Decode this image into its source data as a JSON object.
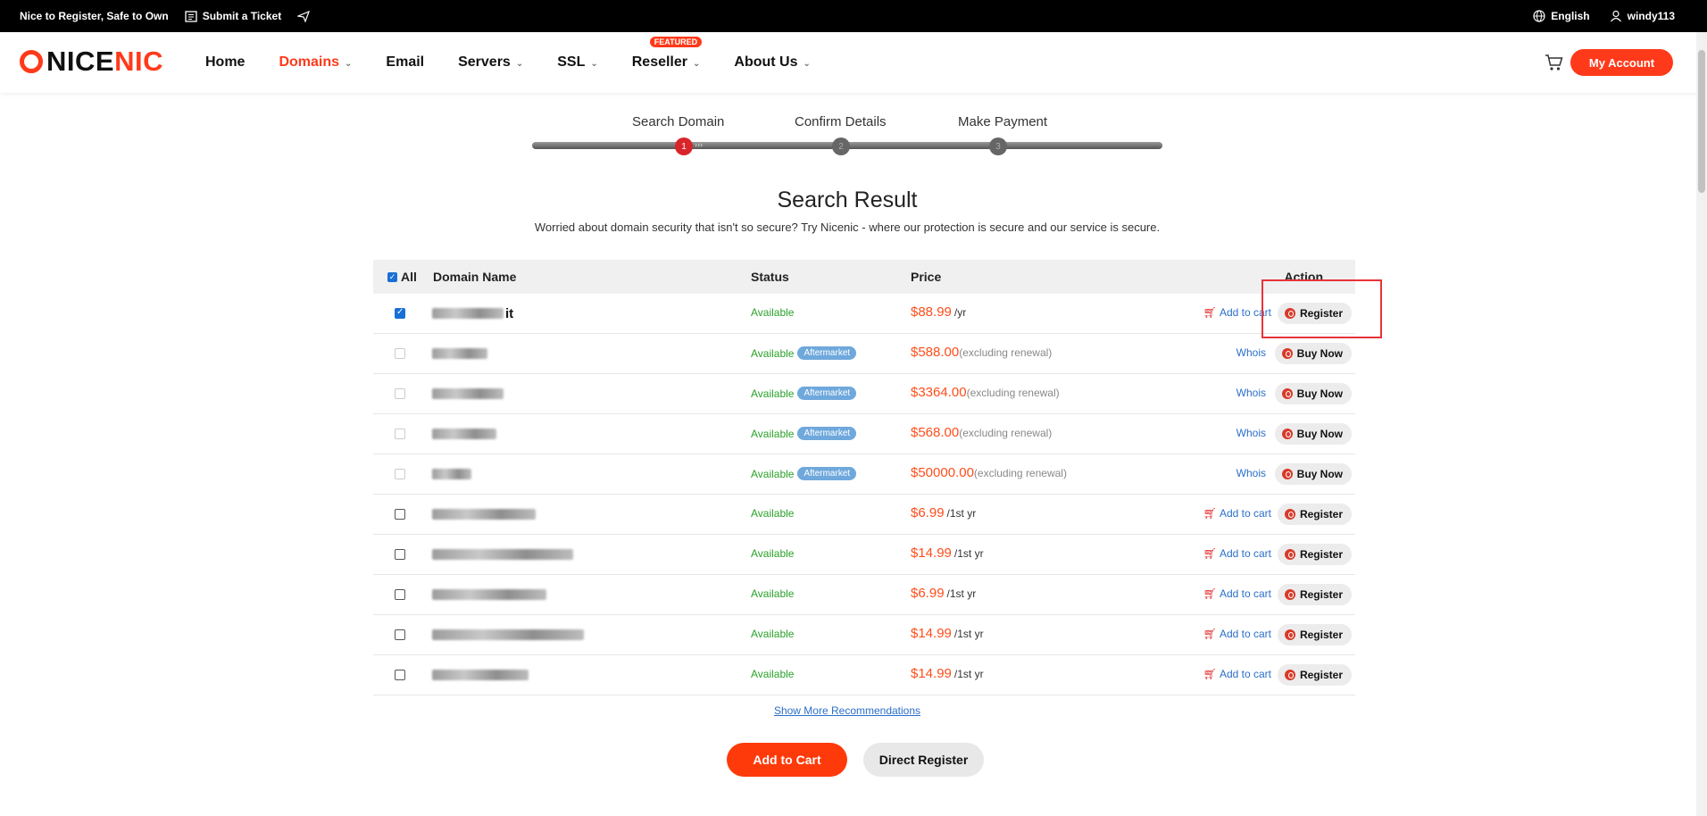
{
  "topbar": {
    "slogan": "Nice to Register, Safe to Own",
    "ticket": "Submit a Ticket",
    "language": "English",
    "username": "windy113"
  },
  "header": {
    "logo_part1": "NICE",
    "logo_part2": "NIC",
    "nav": {
      "home": "Home",
      "domains": "Domains",
      "email": "Email",
      "servers": "Servers",
      "ssl": "SSL",
      "reseller": "Reseller",
      "reseller_badge": "FEATURED",
      "about": "About Us"
    },
    "account": "My Account"
  },
  "steps": {
    "s1": "Search Domain",
    "s2": "Confirm Details",
    "s3": "Make Payment",
    "n1": "1",
    "n2": "2",
    "n3": "3"
  },
  "main": {
    "title": "Search Result",
    "subtitle": "Worried about domain security that isn't so secure? Try Nicenic - where our protection is secure and our service is secure."
  },
  "table": {
    "headers": {
      "all": "All",
      "domain": "Domain Name",
      "status": "Status",
      "price": "Price",
      "action": "Action"
    },
    "rows": [
      {
        "tld": "it",
        "status": "Available",
        "badge": "",
        "amount": "$88.99",
        "unit": "/yr",
        "link": "Add to cart",
        "action": "Register"
      },
      {
        "tld": "",
        "status": "Available",
        "badge": "Aftermarket",
        "amount": "$588.00",
        "unit": "(excluding renewal)",
        "link": "Whois",
        "action": "Buy Now"
      },
      {
        "tld": "",
        "status": "Available",
        "badge": "Aftermarket",
        "amount": "$3364.00",
        "unit": "(excluding renewal)",
        "link": "Whois",
        "action": "Buy Now"
      },
      {
        "tld": "",
        "status": "Available",
        "badge": "Aftermarket",
        "amount": "$568.00",
        "unit": "(excluding renewal)",
        "link": "Whois",
        "action": "Buy Now"
      },
      {
        "tld": "",
        "status": "Available",
        "badge": "Aftermarket",
        "amount": "$50000.00",
        "unit": "(excluding renewal)",
        "link": "Whois",
        "action": "Buy Now"
      },
      {
        "tld": "",
        "status": "Available",
        "badge": "",
        "amount": "$6.99",
        "unit": "/1st yr",
        "link": "Add to cart",
        "action": "Register"
      },
      {
        "tld": "",
        "status": "Available",
        "badge": "",
        "amount": "$14.99",
        "unit": "/1st yr",
        "link": "Add to cart",
        "action": "Register"
      },
      {
        "tld": "",
        "status": "Available",
        "badge": "",
        "amount": "$6.99",
        "unit": "/1st yr",
        "link": "Add to cart",
        "action": "Register"
      },
      {
        "tld": "",
        "status": "Available",
        "badge": "",
        "amount": "$14.99",
        "unit": "/1st yr",
        "link": "Add to cart",
        "action": "Register"
      },
      {
        "tld": "",
        "status": "Available",
        "badge": "",
        "amount": "$14.99",
        "unit": "/1st yr",
        "link": "Add to cart",
        "action": "Register"
      }
    ]
  },
  "footer": {
    "show_more": "Show More Recommendations",
    "add_to_cart": "Add to Cart",
    "direct_register": "Direct Register"
  },
  "colors": {
    "brand": "#ff3a1a",
    "available": "#2aa22a",
    "link": "#2a6fc9",
    "aftermarket_badge": "#6fa8dc"
  }
}
